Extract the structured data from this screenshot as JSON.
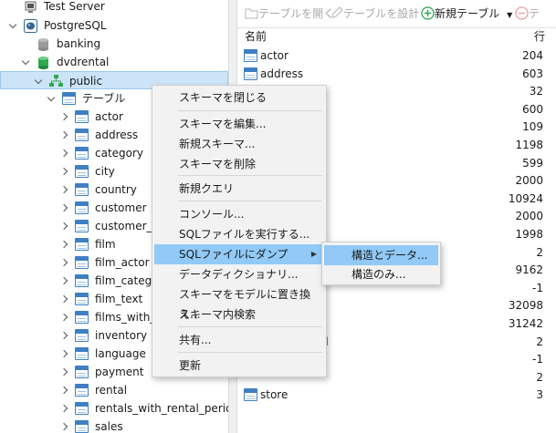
{
  "tree": {
    "server": {
      "label": "Test Server"
    },
    "connection": {
      "label": "PostgreSQL"
    },
    "databases": [
      {
        "label": "banking"
      },
      {
        "label": "dvdrental"
      }
    ],
    "schema": {
      "label": "public"
    },
    "tables_group": {
      "label": "テーブル"
    },
    "tables": [
      {
        "label": "actor"
      },
      {
        "label": "address"
      },
      {
        "label": "category"
      },
      {
        "label": "city"
      },
      {
        "label": "country"
      },
      {
        "label": "customer"
      },
      {
        "label": "customer_a"
      },
      {
        "label": "film"
      },
      {
        "label": "film_actor"
      },
      {
        "label": "film_catego"
      },
      {
        "label": "film_text"
      },
      {
        "label": "films_with_"
      },
      {
        "label": "inventory"
      },
      {
        "label": "language"
      },
      {
        "label": "payment"
      },
      {
        "label": "rental"
      },
      {
        "label": "rentals_with_rental_period"
      },
      {
        "label": "sales"
      }
    ]
  },
  "toolbar": {
    "open_table": "テーブルを開く",
    "design_table": "テーブルを設計",
    "new_table": "新規テーブル",
    "delete_label": "テ"
  },
  "list": {
    "col_name": "名前",
    "col_rows": "行",
    "rows": [
      {
        "name": "actor",
        "count": "204"
      },
      {
        "name": "address",
        "count": "603"
      },
      {
        "name": "",
        "count": "32"
      },
      {
        "name": "",
        "count": "600"
      },
      {
        "name": "",
        "count": "109"
      },
      {
        "name": "",
        "count": "1198"
      },
      {
        "name": "lt",
        "count": "599"
      },
      {
        "name": "",
        "count": "2000"
      },
      {
        "name": "",
        "count": "10924"
      },
      {
        "name": "",
        "count": "2000"
      },
      {
        "name": "",
        "count": "1998"
      },
      {
        "name": "",
        "count": "2"
      },
      {
        "name": "",
        "count": "9162"
      },
      {
        "name": "",
        "count": "-1"
      },
      {
        "name": "",
        "count": "32098"
      },
      {
        "name": "",
        "count": "31242"
      },
      {
        "name": "ental_period",
        "count": "2"
      },
      {
        "name": "",
        "count": "-1"
      },
      {
        "name": "",
        "count": "2"
      },
      {
        "name": "store",
        "count": "3"
      }
    ]
  },
  "context_menu": {
    "items": [
      {
        "label": "スキーマを閉じる"
      },
      {
        "label": "スキーマを編集..."
      },
      {
        "label": "新規スキーマ..."
      },
      {
        "label": "スキーマを削除"
      },
      {
        "label": "新規クエリ"
      },
      {
        "label": "コンソール..."
      },
      {
        "label": "SQLファイルを実行する..."
      },
      {
        "label": "SQLファイルにダンプ"
      },
      {
        "label": "データディクショナリ..."
      },
      {
        "label": "スキーマをモデルに置き換え..."
      },
      {
        "label": "スキーマ内検索"
      },
      {
        "label": "共有..."
      },
      {
        "label": "更新"
      }
    ],
    "submenu": [
      {
        "label": "構造とデータ..."
      },
      {
        "label": "構造のみ..."
      }
    ]
  },
  "colors": {
    "accent": "#0078d7",
    "highlight": "#91c9f7",
    "selection": "#cce4f7"
  }
}
